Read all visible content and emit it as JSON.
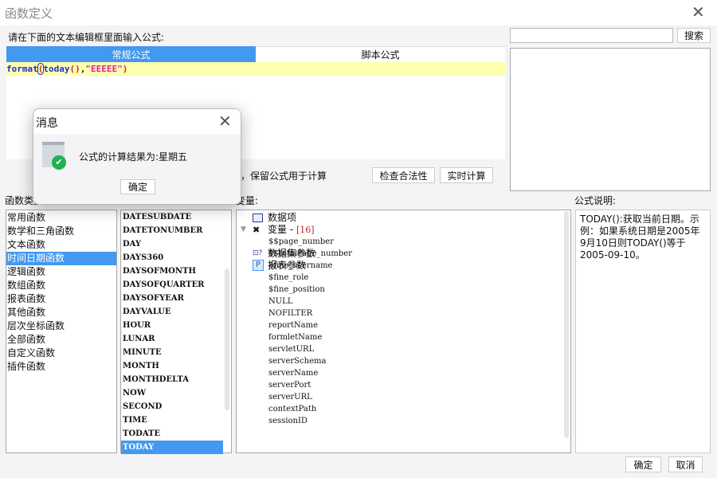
{
  "window": {
    "title": "函数定义"
  },
  "prompt": "请在下面的文本编辑框里面输入公式:",
  "search": {
    "value": "",
    "button": "搜索"
  },
  "tabs": [
    {
      "label": "常规公式"
    },
    {
      "label": "脚本公式"
    }
  ],
  "formula": {
    "fn": "format",
    "open": "(",
    "inner": "today",
    "parens": "()",
    "comma": ",",
    "str": "\"EEEEE\"",
    "close": ")"
  },
  "keep_formula_text": "时，保留公式用于计算",
  "buttons": {
    "check": "检查合法性",
    "realtime": "实时计算",
    "ok": "确定",
    "cancel": "取消"
  },
  "labels": {
    "categories": "函数类型:",
    "variables": "变量:",
    "desc": "公式说明:"
  },
  "categories": [
    "常用函数",
    "数学和三角函数",
    "文本函数",
    "时间日期函数",
    "逻辑函数",
    "数组函数",
    "报表函数",
    "其他函数",
    "层次坐标函数",
    "全部函数",
    "自定义函数",
    "插件函数"
  ],
  "selected_category": "时间日期函数",
  "functions": [
    "DATESUBDATE",
    "DATETONUMBER",
    "DAY",
    "DAYS360",
    "DAYSOFMONTH",
    "DAYSOFQUARTER",
    "DAYSOFYEAR",
    "DAYVALUE",
    "HOUR",
    "LUNAR",
    "MINUTE",
    "MONTH",
    "MONTHDELTA",
    "NOW",
    "SECOND",
    "TIME",
    "TODATE",
    "TODAY"
  ],
  "selected_function": "TODAY",
  "tree": {
    "data_items": "数据项",
    "variables": "变量 - ",
    "count": "[16]",
    "vars": [
      "$$page_number",
      "$$totalPage_number",
      "$fine_username",
      "$fine_role",
      "$fine_position",
      "NULL",
      "NOFILTER",
      "reportName",
      "formletName",
      "servletURL",
      "serverSchema",
      "serverName",
      "serverPort",
      "serverURL",
      "contextPath",
      "sessionID"
    ],
    "dataset_params": "数据集参数",
    "report_params": "报表参数"
  },
  "description": "TODAY():获取当前日期。示例：如果系统日期是2005年9月10日则TODAY()等于2005-09-10。",
  "popup": {
    "title": "消息",
    "message": "公式的计算结果为:星期五",
    "ok": "确定"
  },
  "colors": {
    "accent": "#4399ef",
    "editor_line": "#ffffb0"
  }
}
